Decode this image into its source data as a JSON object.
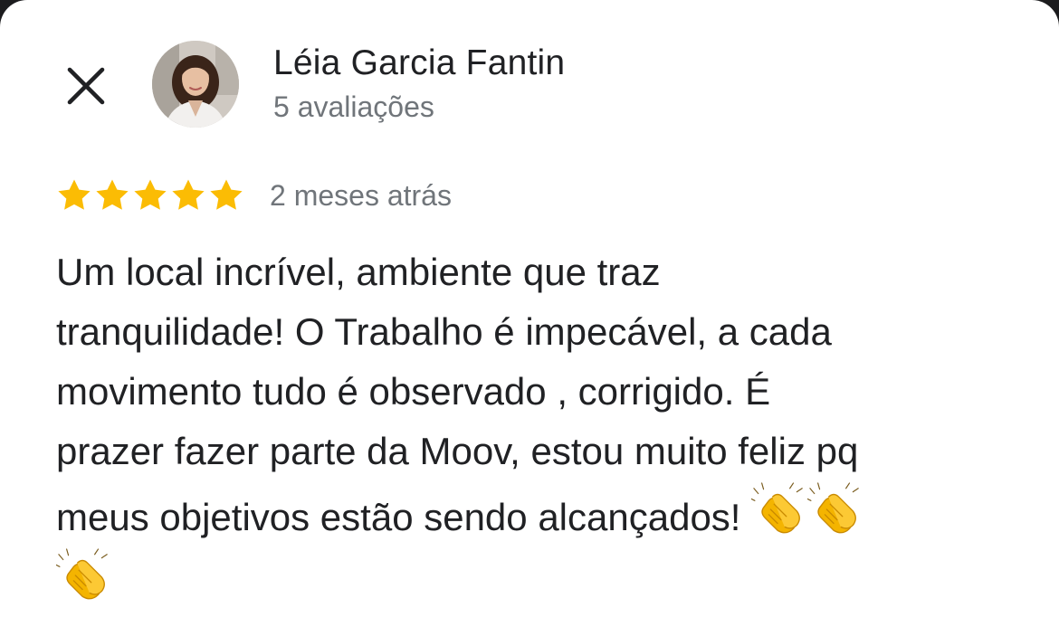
{
  "reviewer": {
    "name": "Léia Garcia Fantin",
    "review_count": "5 avaliações"
  },
  "review": {
    "rating": 5,
    "rating_max": 5,
    "time_ago": "2 meses atrás",
    "lines": [
      "Um local incrível, ambiente que traz",
      "tranquilidade! O Trabalho é impecável, a cada",
      "movimento tudo é observado , corrigido. É",
      "prazer fazer parte da Moov, estou muito feliz pq",
      "meus objetivos estão sendo alcançados! "
    ],
    "emoji_count": 3,
    "emoji_icon": "clapping-hands-icon"
  },
  "colors": {
    "star": "#fbbc04",
    "primary_text": "#202124",
    "secondary_text": "#70757a",
    "background": "#ffffff"
  },
  "icons": {
    "close": "close-icon",
    "star": "star-icon"
  }
}
